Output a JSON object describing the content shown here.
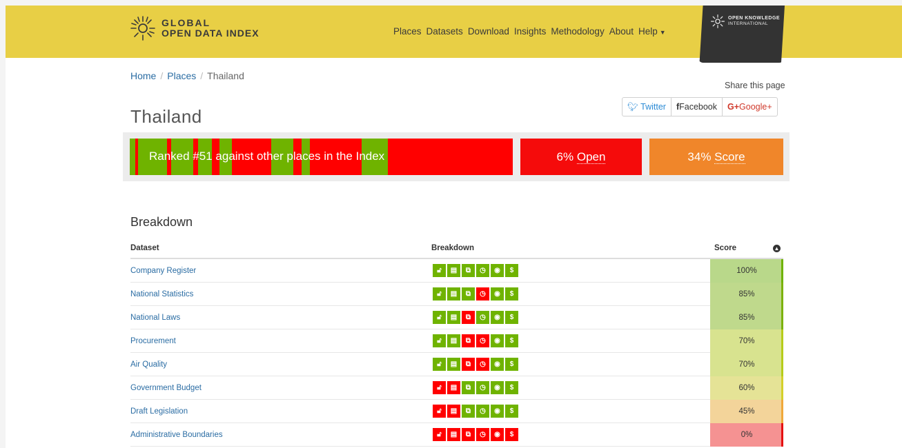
{
  "header": {
    "logo_line1": "GLOBAL",
    "logo_line2": "OPEN DATA INDEX",
    "nav": [
      "Places",
      "Datasets",
      "Download",
      "Insights",
      "Methodology",
      "About",
      "Help"
    ],
    "okf_line1": "OPEN KNOWLEDGE",
    "okf_line2": "INTERNATIONAL"
  },
  "breadcrumb": {
    "home": "Home",
    "places": "Places",
    "current": "Thailand"
  },
  "share": {
    "label": "Share this page",
    "twitter": "Twitter",
    "facebook": "Facebook",
    "google": "Google+"
  },
  "page_title": "Thailand",
  "summary": {
    "rank_text": "Ranked #51 against other places in the Index",
    "open_value": "6%",
    "open_label": "Open",
    "score_value": "34%",
    "score_label": "Score"
  },
  "breakdown": {
    "title": "Breakdown",
    "columns": {
      "dataset": "Dataset",
      "breakdown": "Breakdown",
      "score": "Score"
    },
    "rows": [
      {
        "dataset": "Company Register",
        "score": "100%",
        "flags": [
          1,
          1,
          1,
          1,
          1,
          1
        ],
        "bg": "#b9d88a",
        "edge": "#6fb300"
      },
      {
        "dataset": "National Statistics",
        "score": "85%",
        "flags": [
          1,
          1,
          1,
          0,
          1,
          1
        ],
        "bg": "#bfd98c",
        "edge": "#7cb20a"
      },
      {
        "dataset": "National Laws",
        "score": "85%",
        "flags": [
          1,
          1,
          0,
          1,
          1,
          1
        ],
        "bg": "#bfd98c",
        "edge": "#7cb20a"
      },
      {
        "dataset": "Procurement",
        "score": "70%",
        "flags": [
          1,
          1,
          0,
          0,
          1,
          1
        ],
        "bg": "#d8e38f",
        "edge": "#b6cc1a"
      },
      {
        "dataset": "Air Quality",
        "score": "70%",
        "flags": [
          1,
          1,
          0,
          0,
          1,
          1
        ],
        "bg": "#d8e38f",
        "edge": "#b6cc1a"
      },
      {
        "dataset": "Government Budget",
        "score": "60%",
        "flags": [
          0,
          0,
          1,
          1,
          1,
          1
        ],
        "bg": "#e5e396",
        "edge": "#d4d02a"
      },
      {
        "dataset": "Draft Legislation",
        "score": "45%",
        "flags": [
          0,
          0,
          1,
          1,
          1,
          1
        ],
        "bg": "#f3d49a",
        "edge": "#f0a83a"
      },
      {
        "dataset": "Administrative Boundaries",
        "score": "0%",
        "flags": [
          0,
          0,
          0,
          0,
          0,
          0
        ],
        "bg": "#f59292",
        "edge": "#e51010"
      }
    ],
    "icon_names": [
      "lock-icon",
      "license-icon",
      "copy-icon",
      "clock-icon",
      "eye-icon",
      "dollar-icon"
    ]
  },
  "colors": {
    "header": "#e8cf45",
    "green": "#6fb300",
    "red": "#ff0000",
    "orange": "#f0862a",
    "link": "#2a6ca3"
  }
}
